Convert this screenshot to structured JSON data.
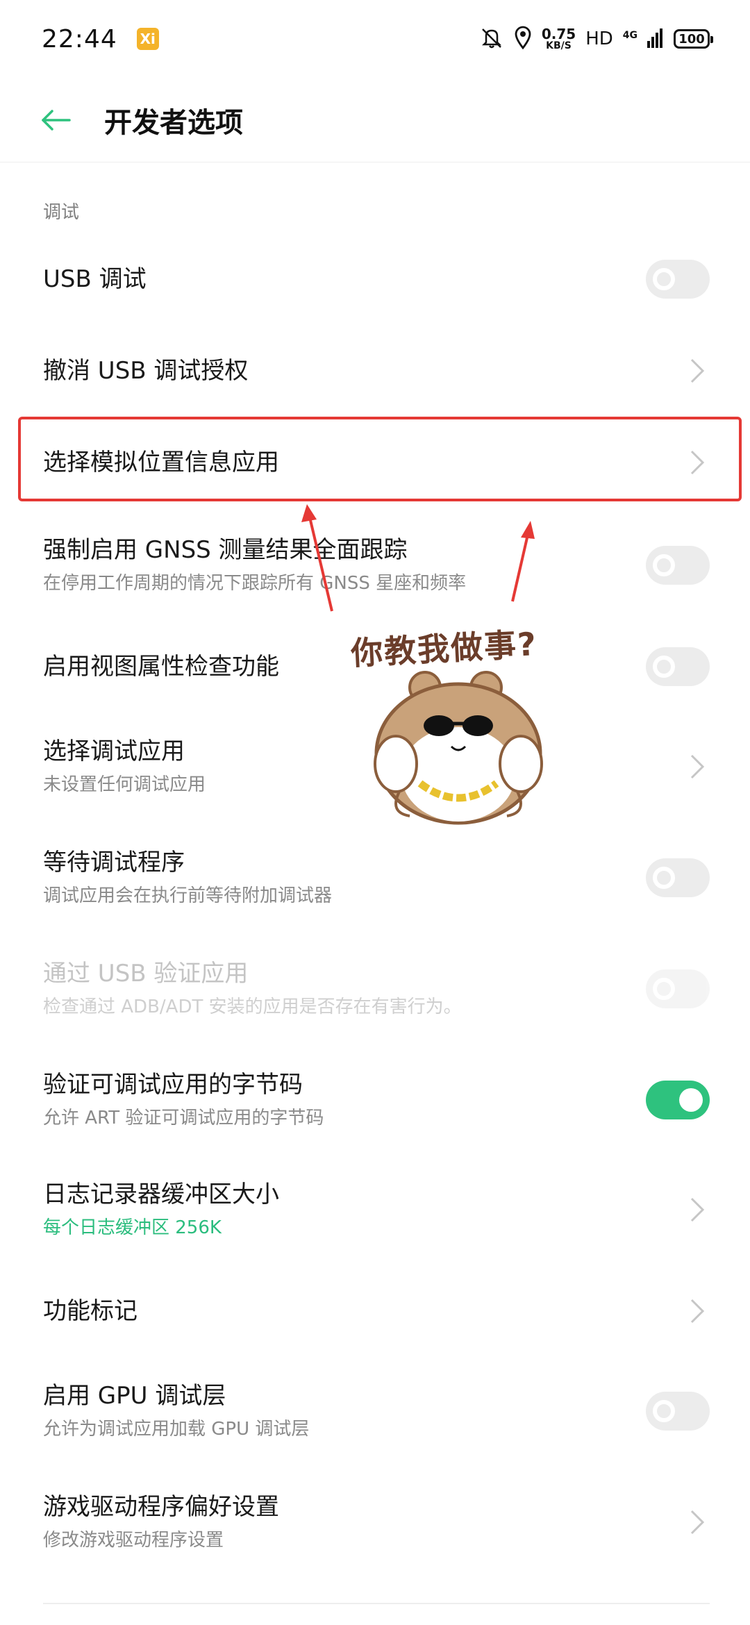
{
  "status_bar": {
    "time": "22:44",
    "app_icon_glyph": "Xi",
    "speed_value": "0.75",
    "speed_unit": "KB/S",
    "hd": "HD",
    "network": "4G",
    "battery": "100",
    "icons": [
      "bell-off-icon",
      "location-icon",
      "signal-icon",
      "battery-icon"
    ]
  },
  "appbar": {
    "title": "开发者选项",
    "back_icon": "arrow-left-icon",
    "accent_color": "#2ec27e"
  },
  "section": {
    "header": "调试"
  },
  "items": [
    {
      "title": "USB 调试",
      "subtitle": "",
      "control": "toggle",
      "state": "off"
    },
    {
      "title": "撤消 USB 调试授权",
      "subtitle": "",
      "control": "chevron"
    },
    {
      "title": "选择模拟位置信息应用",
      "subtitle": "",
      "control": "chevron"
    },
    {
      "title": "强制启用 GNSS 测量结果全面跟踪",
      "subtitle": "在停用工作周期的情况下跟踪所有 GNSS 星座和频率",
      "control": "toggle",
      "state": "off"
    },
    {
      "title": "启用视图属性检查功能",
      "subtitle": "",
      "control": "toggle",
      "state": "off"
    },
    {
      "title": "选择调试应用",
      "subtitle": "未设置任何调试应用",
      "control": "chevron"
    },
    {
      "title": "等待调试程序",
      "subtitle": "调试应用会在执行前等待附加调试器",
      "control": "toggle",
      "state": "off"
    },
    {
      "title": "通过 USB 验证应用",
      "subtitle": "检查通过 ADB/ADT 安装的应用是否存在有害行为。",
      "control": "toggle",
      "state": "off",
      "disabled": true
    },
    {
      "title": "验证可调试应用的字节码",
      "subtitle": "允许 ART 验证可调试应用的字节码",
      "control": "toggle",
      "state": "on"
    },
    {
      "title": "日志记录器缓冲区大小",
      "subtitle": "每个日志缓冲区 256K",
      "control": "chevron",
      "subtitle_accent": true
    },
    {
      "title": "功能标记",
      "subtitle": "",
      "control": "chevron"
    },
    {
      "title": "启用 GPU 调试层",
      "subtitle": "允许为调试应用加载 GPU 调试层",
      "control": "toggle",
      "state": "off"
    },
    {
      "title": "游戏驱动程序偏好设置",
      "subtitle": "修改游戏驱动程序设置",
      "control": "chevron"
    }
  ],
  "sticker": {
    "caption": "你教我做事?",
    "image": "hamster-sticker"
  },
  "annotation_color": "#e53935"
}
